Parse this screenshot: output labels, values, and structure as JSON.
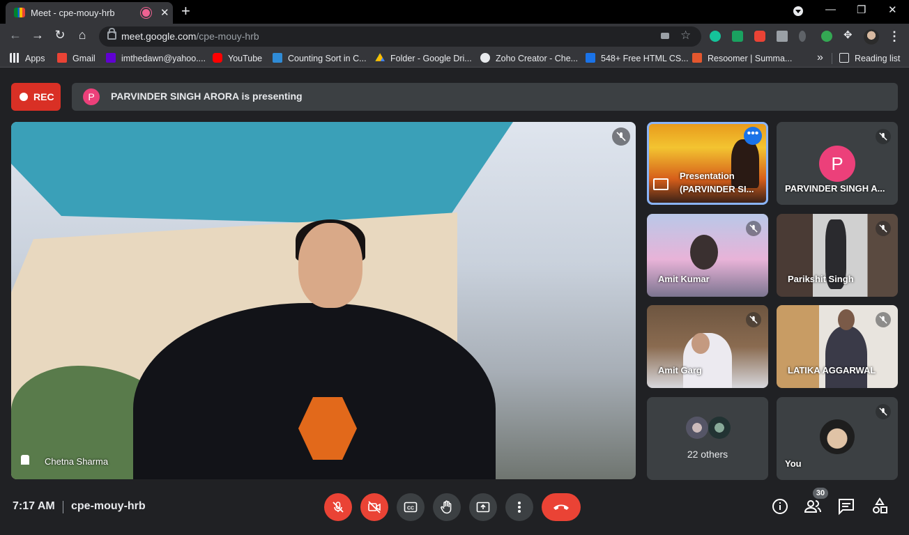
{
  "browser": {
    "tab_title": "Meet - cpe-mouy-hrb",
    "url_host": "meet.google.com",
    "url_path": "/cpe-mouy-hrb",
    "bookmarks": [
      {
        "label": "Apps",
        "icon": "apps-grid-icon",
        "color": "#e8eaed"
      },
      {
        "label": "Gmail",
        "icon": "gmail-icon",
        "color": "#ea4335"
      },
      {
        "label": "imthedawn@yahoo....",
        "icon": "yahoo-icon",
        "color": "#6001d2"
      },
      {
        "label": "YouTube",
        "icon": "youtube-icon",
        "color": "#ff0000"
      },
      {
        "label": "Counting Sort in C...",
        "icon": "site-icon",
        "color": "#2f8bd6"
      },
      {
        "label": "Folder - Google Dri...",
        "icon": "google-drive-icon",
        "color": "#fbbc04"
      },
      {
        "label": "Zoho Creator - Che...",
        "icon": "globe-icon",
        "color": "#e8eaed"
      },
      {
        "label": "548+ Free HTML CS...",
        "icon": "tm-icon",
        "color": "#1a73e8"
      },
      {
        "label": "Resoomer | Summa...",
        "icon": "resoomer-icon",
        "color": "#e4572e"
      }
    ],
    "more_bookmarks": "»",
    "reading_list": "Reading list"
  },
  "meet": {
    "rec_label": "REC",
    "presenter_initial": "P",
    "presenting_text": "PARVINDER SINGH ARORA is presenting",
    "main_speaker": "Chetna Sharma",
    "tiles": {
      "presentation_line1": "Presentation",
      "presentation_line2": "(PARVINDER SI...",
      "parvinder_initial": "P",
      "parvinder": "PARVINDER SINGH A...",
      "amit_kumar": "Amit Kumar",
      "parikshit": "Parikshit Singh",
      "amit_garg": "Amit Garg",
      "latika": "LATIKA AGGARWAL",
      "others": "22 others",
      "you": "You"
    },
    "time": "7:17 AM",
    "meeting_code": "cpe-mouy-hrb",
    "participant_count": "30",
    "colors": {
      "accent_red": "#ea4335",
      "rec_red": "#d93025",
      "avatar_pink": "#ec407a",
      "highlight_blue": "#8ab4f8",
      "tile_bg": "#3c4043",
      "page_bg": "#202124"
    }
  }
}
